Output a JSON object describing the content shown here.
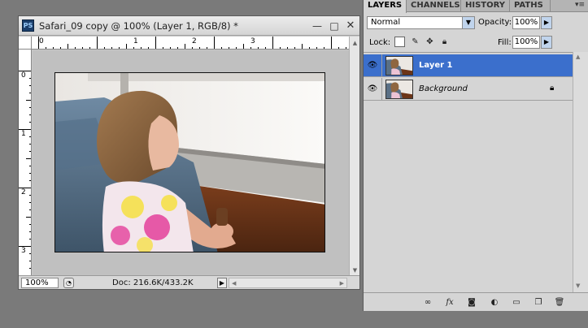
{
  "document": {
    "app_icon": "PS",
    "title": "Safari_09 copy @ 100% (Layer 1, RGB/8) *",
    "minimize_symbol": "—",
    "maximize_symbol": "□",
    "close_symbol": "✕",
    "ruler_top_labels": [
      "0",
      "1",
      "2",
      "3"
    ],
    "ruler_left_labels": [
      "0",
      "1",
      "2",
      "3"
    ],
    "zoom": "100%",
    "doc_size": "Doc: 216.6K/433.2K",
    "status_arrow": "▶",
    "photo_description_icon": "child-photo"
  },
  "layers_panel": {
    "tabs": [
      "LAYERS",
      "CHANNELS",
      "HISTORY",
      "PATHS"
    ],
    "active_tab": "LAYERS",
    "menu_symbol": "▾≡",
    "blend_mode": "Normal",
    "opacity_label": "Opacity:",
    "opacity": "100%",
    "lock_label": "Lock:",
    "fill_label": "Fill:",
    "fill": "100%",
    "layers": [
      {
        "name": "Layer 1",
        "selected": true,
        "visible": true
      },
      {
        "name": "Background",
        "selected": false,
        "visible": true,
        "locked": true
      }
    ],
    "footer_icons": [
      "link-icon",
      "fx-icon",
      "mask-icon",
      "adjustment-icon",
      "folder-icon",
      "new-layer-icon",
      "trash-icon"
    ]
  },
  "colors": {
    "selection": "#3b6fcc",
    "panel_bg": "#d5d5d5",
    "workspace": "#7a7a7a"
  }
}
